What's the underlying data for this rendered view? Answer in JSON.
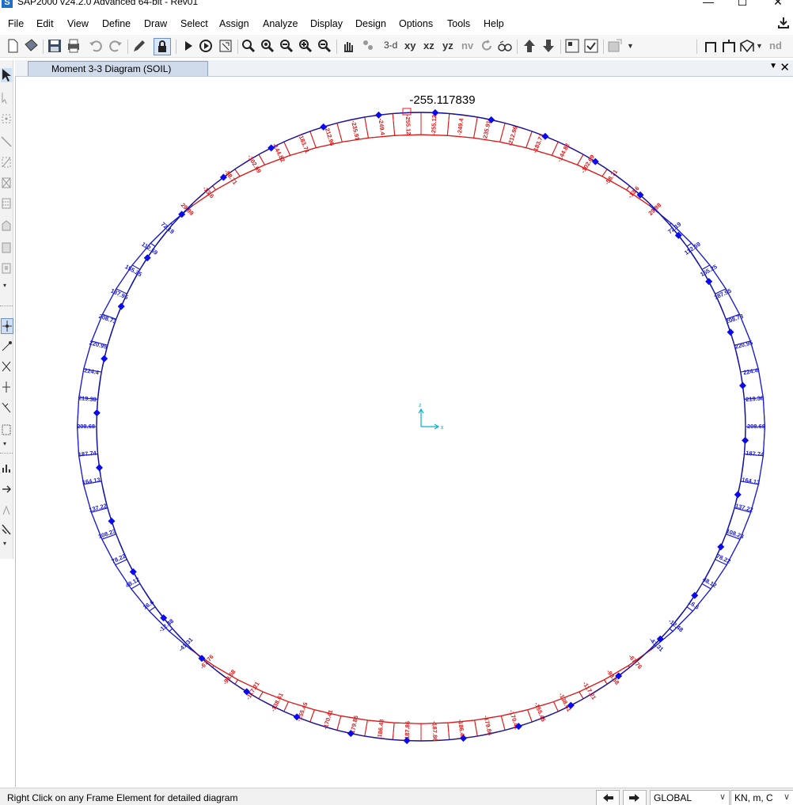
{
  "window": {
    "title": "SAP2000 v24.2.0 Advanced 64-bit - Rev01",
    "app_icon_letter": "S",
    "minimize": "—",
    "maximize": "☐",
    "close": "✕"
  },
  "menu": [
    "File",
    "Edit",
    "View",
    "Define",
    "Draw",
    "Select",
    "Assign",
    "Analyze",
    "Display",
    "Design",
    "Options",
    "Tools",
    "Help"
  ],
  "toolbar": {
    "view_3d": "3-d",
    "view_xy": "xy",
    "view_xz": "xz",
    "view_yz": "yz",
    "view_nv": "nv",
    "nd_label": "nd"
  },
  "tab": {
    "label": "Moment 3-3 Diagram (SOIL)",
    "dropdown": "▼",
    "close": "✕"
  },
  "diagram": {
    "max_label": "-255.117839",
    "axis_z": "z",
    "axis_x": "x",
    "colors": {
      "positive": "#1a1ad6",
      "negative": "#e01818",
      "joint": "#0a0aee",
      "axis": "#00b4d8"
    }
  },
  "moment_labels": {
    "right": [
      "-255.12",
      "-249.4",
      "-235.91",
      "-212.96",
      "-183.71",
      "-144.82",
      "-102.69",
      "-58.71",
      "-13.6",
      "29.98",
      "72.19",
      "112.59",
      "155.25",
      "187.95",
      "208.73",
      "220.95",
      "224.4",
      "219.38",
      "208.68",
      "187.74",
      "164.13",
      "137.22",
      "108.23",
      "78.22",
      "48.12",
      "16.6",
      "-12.48",
      "-41.31",
      "-67.76",
      "-93.58",
      "-117.21",
      "-138.61",
      "-155.45",
      "-170.41",
      "-179.86",
      "-186.43",
      "-187.86"
    ],
    "left": [
      "-255.12",
      "-249.4",
      "-235.91",
      "-212.96",
      "-183.71",
      "-144.82",
      "-102.69",
      "-58.71",
      "-13.6",
      "29.98",
      "72.19",
      "112.59",
      "155.25",
      "187.95",
      "208.73",
      "220.95",
      "224.4",
      "219.38",
      "208.68",
      "187.74",
      "164.13",
      "137.22",
      "108.23",
      "78.22",
      "48.12",
      "16.6",
      "-12.48",
      "-41.31",
      "-67.76",
      "-93.58",
      "-117.21",
      "-138.61",
      "-155.45",
      "-170.41",
      "-179.86",
      "-186.43",
      "-187.86"
    ]
  },
  "status": {
    "hint": "Right Click on any Frame Element for detailed diagram",
    "coord_system": "GLOBAL",
    "units": "KN, m, C"
  }
}
